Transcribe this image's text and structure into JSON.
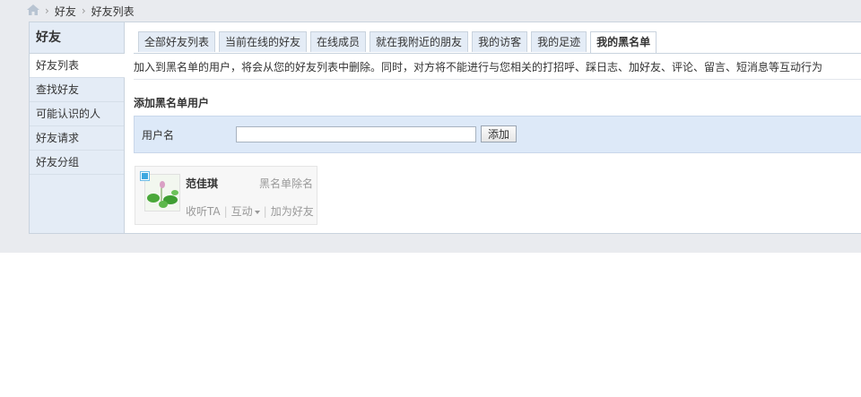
{
  "breadcrumb": {
    "home_icon": "home-icon",
    "items": [
      "好友",
      "好友列表"
    ],
    "separator": "›"
  },
  "sidebar": {
    "title": "好友",
    "items": [
      {
        "label": "好友列表",
        "active": true
      },
      {
        "label": "查找好友",
        "active": false
      },
      {
        "label": "可能认识的人",
        "active": false
      },
      {
        "label": "好友请求",
        "active": false
      },
      {
        "label": "好友分组",
        "active": false
      }
    ]
  },
  "tabs": [
    {
      "label": "全部好友列表",
      "active": false
    },
    {
      "label": "当前在线的好友",
      "active": false
    },
    {
      "label": "在线成员",
      "active": false
    },
    {
      "label": "就在我附近的朋友",
      "active": false
    },
    {
      "label": "我的访客",
      "active": false
    },
    {
      "label": "我的足迹",
      "active": false
    },
    {
      "label": "我的黑名单",
      "active": true
    }
  ],
  "notice": "加入到黑名单的用户，将会从您的好友列表中删除。同时，对方将不能进行与您相关的打招呼、踩日志、加好友、评论、留言、短消息等互动行为",
  "add_section": {
    "title": "添加黑名单用户",
    "label": "用户名",
    "input_value": "",
    "button": "添加"
  },
  "card": {
    "name": "范佳琪",
    "remove": "黑名单除名",
    "actions": {
      "follow": "收听TA",
      "interact": "互动",
      "add": "加为好友"
    },
    "separator": "|"
  },
  "colors": {
    "page_bg": "#e9ebef",
    "sidebar_bg": "#e4ecf6",
    "form_bg": "#dde9f8",
    "online_dot": "#3ea8e0"
  }
}
